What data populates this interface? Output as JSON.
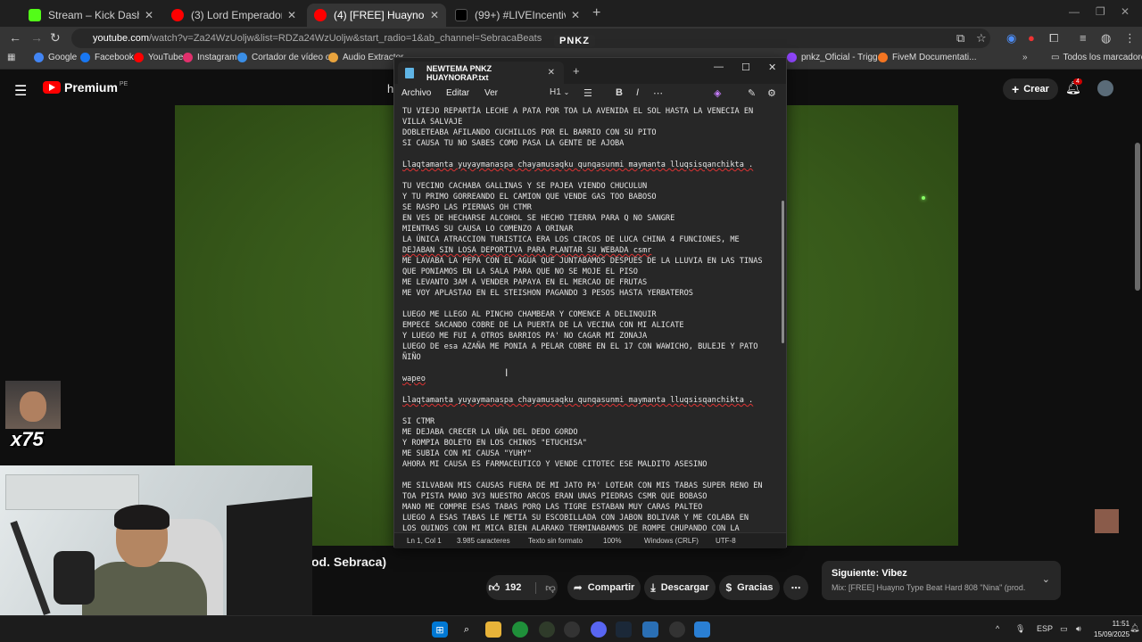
{
  "browser": {
    "tabs": [
      {
        "title": "Stream – Kick Dashboard",
        "favicon_color": "#53fc18"
      },
      {
        "title": "(3) Lord Emperador – El Desper",
        "favicon_color": "#ff0000"
      },
      {
        "title": "(4) [FREE] Huayno Type Beat",
        "favicon_color": "#ff0000"
      },
      {
        "title": "(99+) #LIVEIncentiveProgram #",
        "favicon_color": "#000000"
      }
    ],
    "url_host": "youtube.com",
    "url_rest": "/watch?v=Za24WzUoljw&list=RDZa24WzUoljw&start_radio=1&ab_channel=SebracaBeats",
    "overlay_tag": "PNKZ",
    "bookmarks": [
      {
        "label": "Google",
        "color": "#4285f4"
      },
      {
        "label": "Facebook",
        "color": "#1877f2"
      },
      {
        "label": "YouTube",
        "color": "#ff0000"
      },
      {
        "label": "Instagram",
        "color": "#e1306c"
      },
      {
        "label": "Cortador de vídeo o...",
        "color": "#3a8ee6"
      },
      {
        "label": "Audio Extractor",
        "color": "#e8a33d"
      },
      {
        "label": "pnkz_Oficial - Trigg...",
        "color": "#9146ff"
      },
      {
        "label": "FiveM Documentati...",
        "color": "#f47521"
      }
    ],
    "all_bookmarks": "Todos los marcadores"
  },
  "youtube": {
    "logo": "Premium",
    "logo_region": "PE",
    "search_partial": "h",
    "create_label": "Crear",
    "notif_count": "4",
    "video_title_partial": "od. Sebraca)",
    "likes": "192",
    "share_label": "Compartir",
    "download_label": "Descargar",
    "thanks_label": "Gracias",
    "next_label": "Siguiente: Vibez",
    "next_mix": "Mix: [FREE] Huayno Type Beat Hard 808 \"Nina\" (prod. Sebrac..."
  },
  "overlay": {
    "multiplier": "x75"
  },
  "notepad": {
    "tab_title": "NEWTEMA PNKZ HUAYNORAP.txt",
    "menu": [
      "Archivo",
      "Editar",
      "Ver"
    ],
    "heading_style": "H1",
    "lines": [
      "TU VIEJO REPARTÍA LECHE A PATA POR TOA LA AVENIDA EL SOL HASTA LA VENECIA EN",
      "VILLA SALVAJE",
      "DOBLETEABA AFILANDO CUCHILLOS POR EL BARRIO CON SU PITO",
      "SI CAUSA TU NO SABES COMO PASA LA GENTE DE AJOBA",
      "",
      "Llaqtamanta yuyaymanaspa chayamusaqku qunqasunmi maymanta lluqsisqanchikta .",
      "",
      "TU VECINO CACHABA GALLINAS Y SE PAJEA VIENDO CHUCULUN",
      "Y TU PRIMO GORREANDO EL CAMION QUE VENDE GAS TOO BABOSO",
      "SE RASPO LAS PIERNAS OH CTMR",
      "EN VES DE HECHARSE ALCOHOL SE HECHO TIERRA PARA Q NO SANGRE",
      "MIENTRAS SU CAUSA LO COMENZO A ORINAR",
      "LA ÚNICA ATRACCION TURISTICA ERA LOS CIRCOS DE LUCA CHINA 4 FUNCIONES, ME",
      "DEJABAN SIN LOSA DEPORTIVA PARA PLANTAR SU WEBADA csmr",
      "ME LAVABA LA PEPA CON EL AGUA QUE JUNTABAMOS DESPUES DE LA LLUVIA EN LAS TINAS",
      "QUE PONIAMOS EN LA SALA PARA QUE NO SE MOJE EL PISO",
      "ME LEVANTO 3AM A VENDER PAPAYA EN EL MERCAO DE FRUTAS",
      "ME VOY APLASTAO EN EL STEISHON PAGANDO 3 PESOS HASTA YERBATEROS",
      "",
      "LUEGO ME LLEGO AL PINCHO CHAMBEAR Y COMENCE A DELINQUIR",
      "EMPECE SACANDO COBRE DE LA PUERTA DE LA VECINA CON MI ALICATE",
      "Y LUEGO ME FUI A OTROS BARRIOS PA' NO CAGAR MI ZONAJA",
      "LUEGO DE esa AZAÑA ME PONIA A PELAR COBRE EN EL 17 CON WAWICHO, BULEJE Y PATO",
      "ÑIÑO",
      "",
      "wapeo",
      "",
      "Llaqtamanta yuyaymanaspa chayamusaqku qunqasunmi maymanta lluqsisqanchikta .",
      "",
      "SI CTMR",
      "ME DEJABA CRECER LA UÑA DEL DEDO GORDO",
      "Y ROMPIA BOLETO EN LOS CHINOS \"ETUCHISA\"",
      "ME SUBIA CON MI CAUSA \"YUHY\"",
      "AHORA MI CAUSA ES FARMACEUTICO Y VENDE CITOTEC ESE MALDITO ASESINO",
      "",
      "ME SILVABAN MIS CAUSAS FUERA DE MI JATO PA' LOTEAR CON MIS TABAS SUPER RENO EN",
      "TOA PISTA MANO 3V3 NUESTRO ARCOS ERAN UNAS PIEDRAS CSMR QUE BOBASO",
      "MANO ME COMPRE ESAS TABAS PORQ LAS TIGRE ESTABAN MUY CARAS PALTEO",
      "LUEGO A ESAS TABAS LE METIA SU ESCOBILLADA CON JABON BOLIVAR Y ME COLABA EN",
      "LOS QUINOS CON MI MICA BIEN ALARAKO TERMINABAMOS DE ROMPE CHUPANDO CON LA"
    ],
    "underlined_lines": [
      5,
      13,
      25,
      27
    ],
    "status": {
      "position": "Ln 1, Col 1",
      "chars": "3.985 caracteres",
      "format": "Texto sin formato",
      "zoom": "100%",
      "eol": "Windows (CRLF)",
      "encoding": "UTF-8"
    }
  },
  "taskbar": {
    "lang": "ESP",
    "time": "11:51",
    "date": "15/09/2025"
  }
}
